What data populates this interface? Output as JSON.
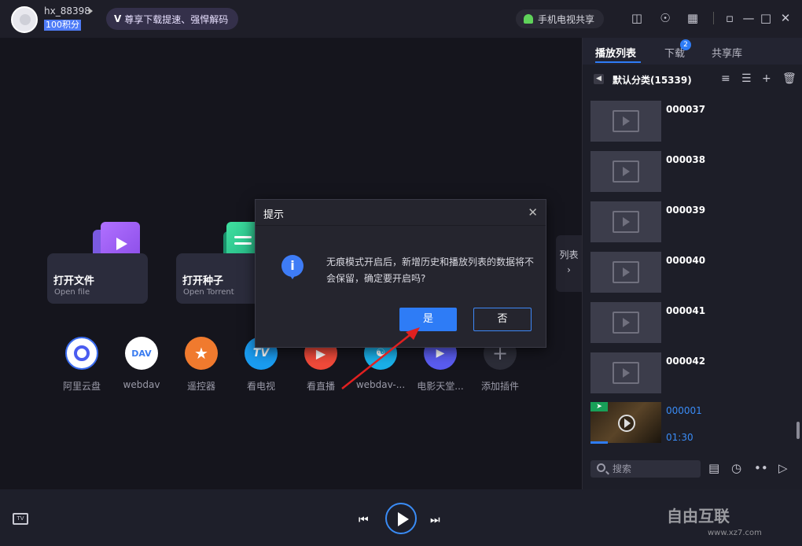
{
  "topbar": {
    "username": "hx_88398",
    "points": "100积分",
    "promo_v": "V",
    "promo": "尊享下载提速、强悍解码",
    "share": "手机电视共享"
  },
  "main": {
    "cards": [
      {
        "title": "打开文件",
        "sub": "Open file"
      },
      {
        "title": "打开种子",
        "sub": "Open Torrent"
      }
    ],
    "plugins": [
      "阿里云盘",
      "webdav",
      "遥控器",
      "看电视",
      "看直播",
      "webdav-...",
      "电影天堂...",
      "添加插件"
    ],
    "plugin_glyphs": {
      "webdav": "DAV",
      "tv": "TV",
      "add": "+"
    },
    "list_toggle": "列表"
  },
  "dialog": {
    "title": "提示",
    "message": "无痕模式开启后，新增历史和播放列表的数据将不会保留，确定要开启吗?",
    "yes": "是",
    "no": "否"
  },
  "panel": {
    "tabs": [
      "播放列表",
      "下载",
      "共享库"
    ],
    "download_badge": "2",
    "category": "默认分类(15339)",
    "items": [
      "000037",
      "000038",
      "000039",
      "000040",
      "000041",
      "000042"
    ],
    "current": {
      "name": "000001",
      "time": "01:30"
    },
    "search_placeholder": "搜索"
  },
  "bottom": {
    "tv_icon_text": "TV",
    "watermark": "自由互联",
    "watermark_url": "www.xz7.com"
  },
  "colors": {
    "accent": "#2e7cf6",
    "bg": "#15151d"
  }
}
